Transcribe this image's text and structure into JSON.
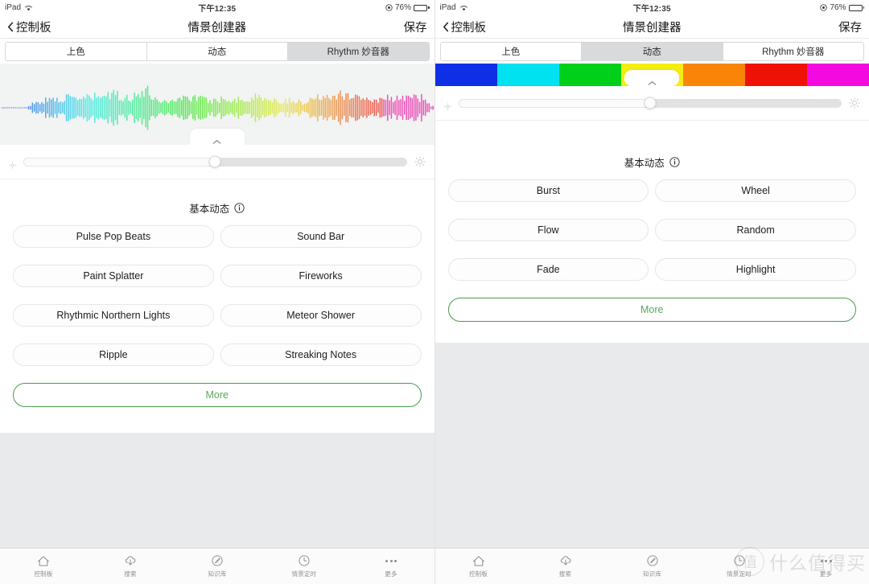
{
  "status_bar": {
    "device": "iPad",
    "time": "下午12:35",
    "battery": "76%",
    "battery_level": 76,
    "wifi_icon": "wifi-icon",
    "location_icon": "location-icon",
    "battery_icon": "battery-icon"
  },
  "nav": {
    "back_label": "控制板",
    "title": "情景创建器",
    "save_label": "保存",
    "back_icon": "chevron-left-icon"
  },
  "tabs": {
    "items": [
      {
        "label": "上色"
      },
      {
        "label": "动态"
      },
      {
        "label": "Rhythm 妙音器"
      }
    ],
    "left_active_index": 2,
    "right_active_index": 1
  },
  "left_panel": {
    "preview_type": "audio-waveform",
    "pull_tab_icon": "chevron-up-icon",
    "slider": {
      "value_percent": 50,
      "min_icon": "sun-small-icon",
      "max_icon": "sun-large-icon"
    },
    "section": {
      "title": "基本动态",
      "info_icon": "info-icon"
    },
    "options": [
      "Pulse Pop Beats",
      "Sound Bar",
      "Paint Splatter",
      "Fireworks",
      "Rhythmic Northern Lights",
      "Meteor Shower",
      "Ripple",
      "Streaking Notes"
    ],
    "more_label": "More"
  },
  "right_panel": {
    "preview_type": "color-strip",
    "colors": [
      "#0f2fe6",
      "#00e2f0",
      "#00d01a",
      "#f5ec10",
      "#f98407",
      "#ee1206",
      "#f40ae0"
    ],
    "pull_tab_icon": "chevron-up-icon",
    "slider": {
      "value_percent": 50,
      "min_icon": "sun-small-icon",
      "max_icon": "sun-large-icon"
    },
    "section": {
      "title": "基本动态",
      "info_icon": "info-icon"
    },
    "options": [
      "Burst",
      "Wheel",
      "Flow",
      "Random",
      "Fade",
      "Highlight"
    ],
    "more_label": "More"
  },
  "tab_bar": {
    "items": [
      {
        "label": "控制板",
        "icon": "home-icon"
      },
      {
        "label": "搜索",
        "icon": "cloud-download-icon"
      },
      {
        "label": "知识库",
        "icon": "compass-pen-icon"
      },
      {
        "label": "情景定时",
        "icon": "clock-icon"
      },
      {
        "label": "更多",
        "icon": "more-dots-icon"
      }
    ]
  },
  "watermark": {
    "mark": "值",
    "text": "什么值得买"
  },
  "theme": {
    "accent_green": "#57a957",
    "selected_segment_bg": "#d8dadc",
    "page_bg": "#e9eaec",
    "waveform_bg": "#f2f3f3"
  }
}
